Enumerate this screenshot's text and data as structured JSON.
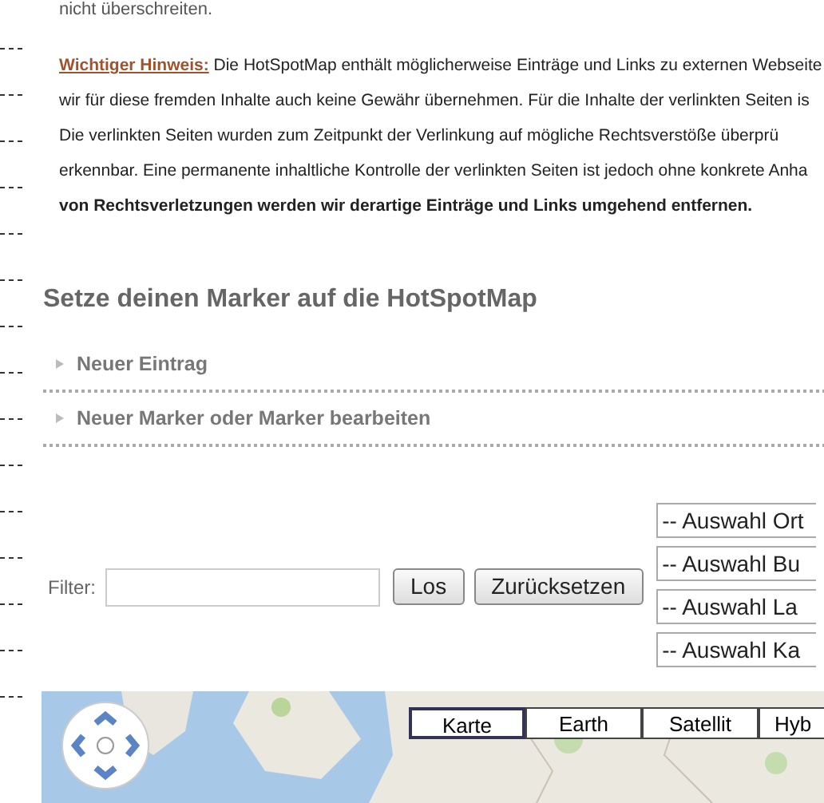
{
  "top_text": "nicht überschreiten.",
  "notice": {
    "label": "Wichtiger Hinweis:",
    "lines": [
      "Die HotSpotMap enthält möglicherweise Einträge und Links zu externen Webseite",
      "wir für diese fremden Inhalte auch keine Gewähr übernehmen. Für die Inhalte der verlinkten Seiten is",
      "Die verlinkten Seiten wurden zum Zeitpunkt der Verlinkung auf mögliche Rechtsverstöße überprü",
      "erkennbar. Eine permanente inhaltliche Kontrolle der verlinkten Seiten ist jedoch ohne konkrete Anha"
    ],
    "bold_line": "von Rechtsverletzungen werden wir derartige Einträge und Links umgehend entfernen."
  },
  "heading": "Setze deinen Marker auf die HotSpotMap",
  "accordion": [
    {
      "label": "Neuer Eintrag",
      "expanded": false
    },
    {
      "label": "Neuer Marker oder Marker bearbeiten",
      "expanded": false
    }
  ],
  "filter": {
    "label": "Filter:",
    "buttons": [
      "Los",
      "Zurücksetzen"
    ]
  },
  "selects": [
    "-- Auswahl Ort",
    "-- Auswahl Bu",
    "-- Auswahl La",
    "-- Auswahl Ka"
  ],
  "map": {
    "kind": "picture",
    "map_types": [
      {
        "label": "Karte",
        "selected": true
      },
      {
        "label": "Earth",
        "selected": false
      },
      {
        "label": "Satellit",
        "selected": false
      },
      {
        "label": "Hyb",
        "selected": false
      }
    ]
  }
}
